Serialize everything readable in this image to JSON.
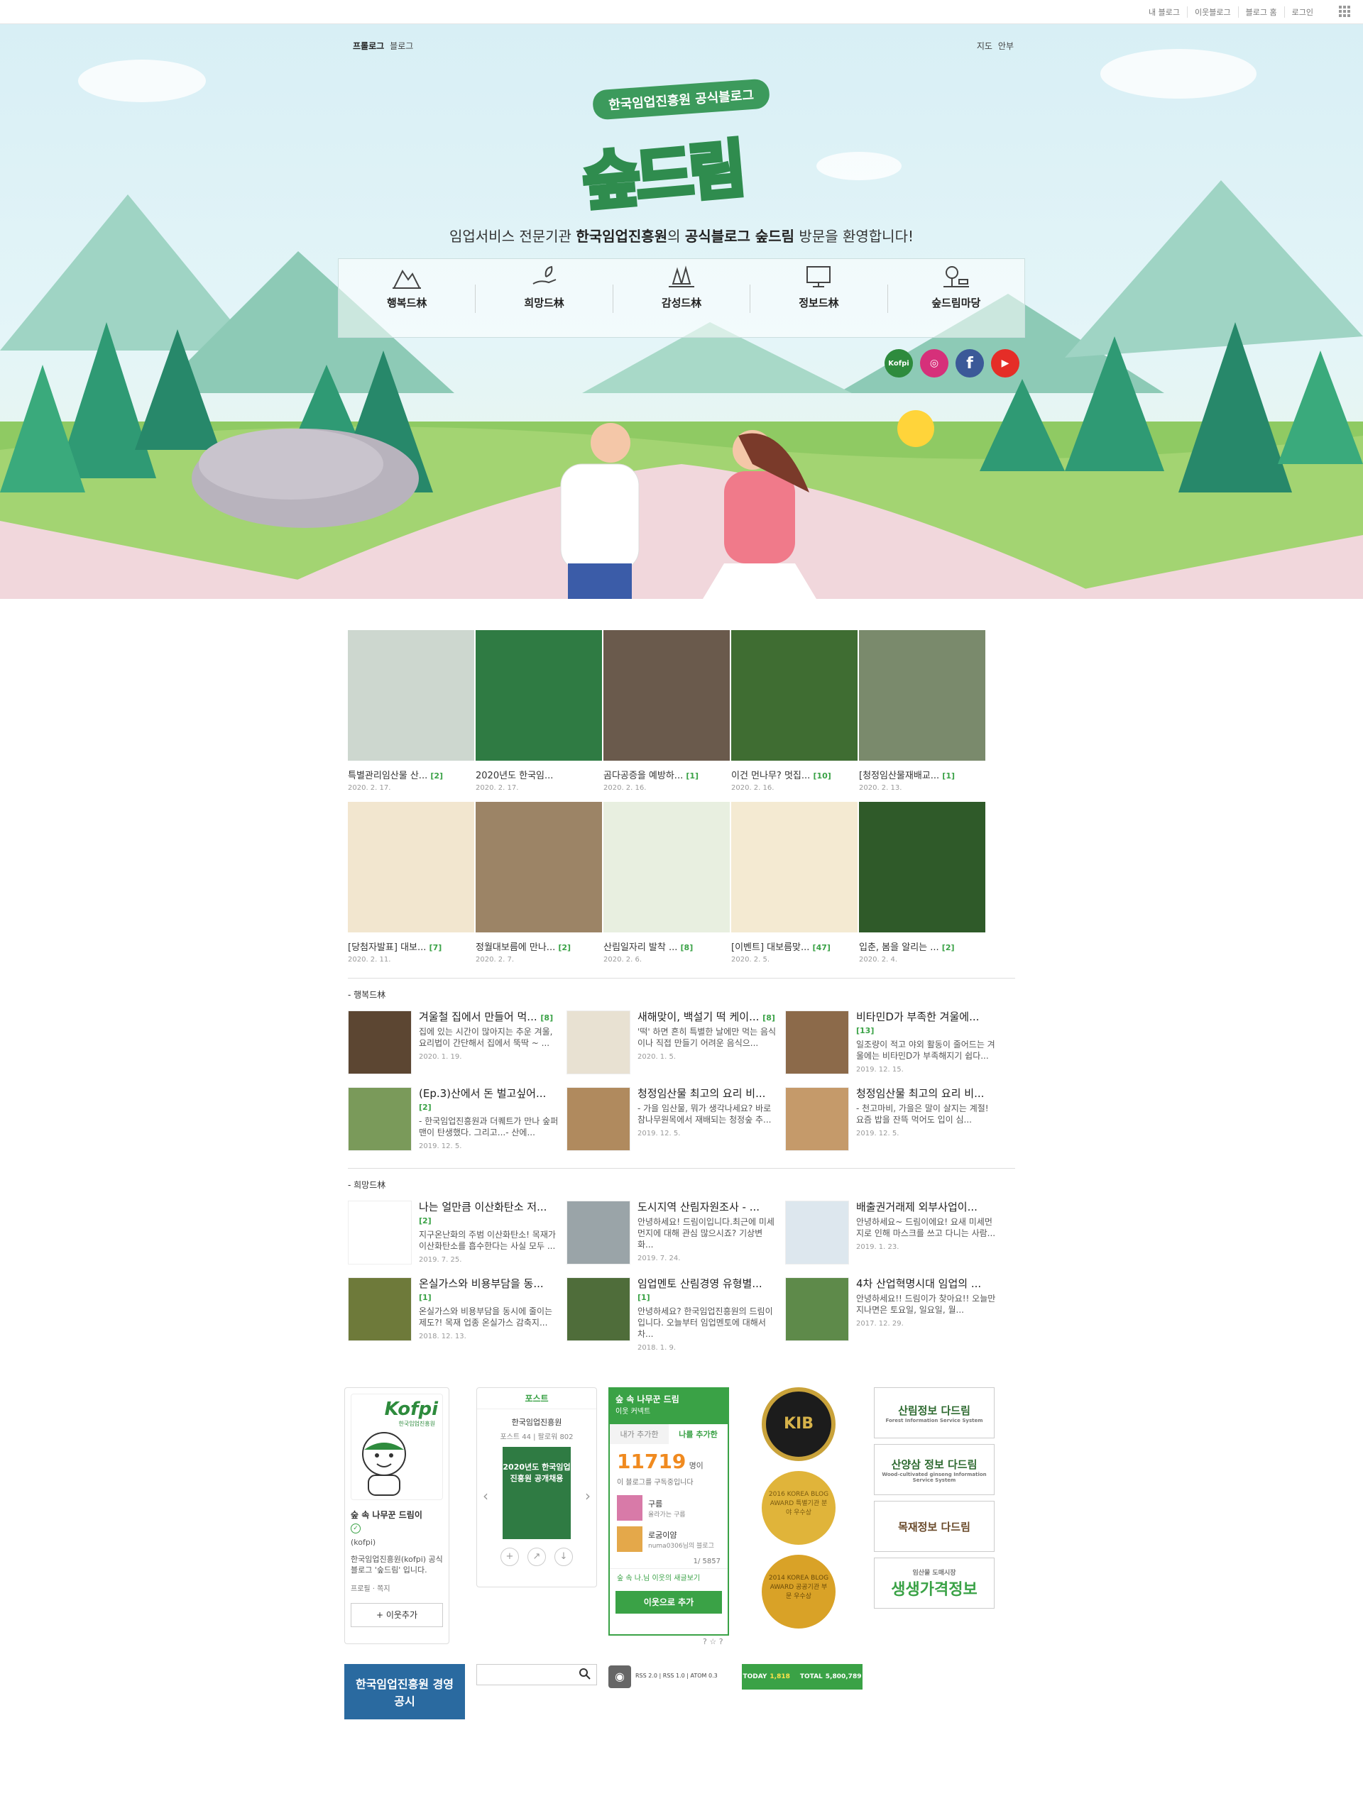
{
  "topbar": {
    "links": [
      "내 블로그",
      "이웃블로그",
      "블로그 홈",
      "로그인"
    ]
  },
  "hero": {
    "nav_left": [
      "프롤로그",
      "블로그"
    ],
    "nav_right": [
      "지도",
      "안부"
    ],
    "badge": "한국임업진흥원 공식블로그",
    "logo": "숲드림",
    "welcome_pre": "임업서비스 전문기관 ",
    "welcome_org": "한국임업진흥원",
    "welcome_mid": "의 ",
    "welcome_blog": "공식블로그 숲드림",
    "welcome_post": " 방문을 환영합니다!",
    "categories": [
      "행복드林",
      "희망드林",
      "감성드林",
      "정보드林",
      "숲드림마당"
    ],
    "sns": [
      {
        "name": "kofpi",
        "label": "Kofpi",
        "color": "#2e8b3d"
      },
      {
        "name": "instagram",
        "label": "◎",
        "color": "#d6307a"
      },
      {
        "name": "facebook",
        "label": "f",
        "color": "#3b5998"
      },
      {
        "name": "youtube",
        "label": "▶",
        "color": "#e52d27"
      }
    ]
  },
  "thumbs": [
    {
      "title": "특별관리임산물 산...",
      "count": "[2]",
      "date": "2020. 2. 17.",
      "color": "#cdd7cf"
    },
    {
      "title": "2020년도 한국임...",
      "count": "",
      "date": "2020. 2. 17.",
      "color": "#2f7b43"
    },
    {
      "title": "곰다공증을 예방하...",
      "count": "[1]",
      "date": "2020. 2. 16.",
      "color": "#6a5a4c"
    },
    {
      "title": "이건 먼나무? 멋집...",
      "count": "[10]",
      "date": "2020. 2. 16.",
      "color": "#3f6d32"
    },
    {
      "title": "[청정임산물재배교...",
      "count": "[1]",
      "date": "2020. 2. 13.",
      "color": "#7a8a6c"
    },
    {
      "title": "[당첨자발표] 대보...",
      "count": "[7]",
      "date": "2020. 2. 11.",
      "color": "#f2e6cf"
    },
    {
      "title": "정월대보름에 만나...",
      "count": "[2]",
      "date": "2020. 2. 7.",
      "color": "#9c8466"
    },
    {
      "title": "산림일자리 발착 ...",
      "count": "[8]",
      "date": "2020. 2. 6.",
      "color": "#e8efe0"
    },
    {
      "title": "[이벤트] 대보름맞...",
      "count": "[47]",
      "date": "2020. 2. 5.",
      "color": "#f4ead2"
    },
    {
      "title": "입춘, 봄을 알리는 ...",
      "count": "[2]",
      "date": "2020. 2. 4.",
      "color": "#2f5a29"
    }
  ],
  "section1": {
    "title": "- 행복드林",
    "items": [
      {
        "title": "겨울철 집에서 만들어 먹...",
        "count": "[8]",
        "desc": "집에 있는 시간이 많아지는 추운 겨울, 요리법이 간단해서 집에서 뚝딱 ~ ...",
        "date": "2020. 1. 19.",
        "color": "#5c4632"
      },
      {
        "title": "새해맞이, 백설기 떡 케이...",
        "count": "[8]",
        "desc": "'떡' 하면 흔히 특별한 날에만 먹는 음식이나 직접 만들기 어려운 음식으...",
        "date": "2020. 1. 5.",
        "color": "#e8e1d2"
      },
      {
        "title": "비타민D가 부족한 겨울에...",
        "count": "[13]",
        "desc": "일조량이 적고 야외 활동이 줄어드는 겨울에는 비타민D가 부족해지기 쉽다...",
        "date": "2019. 12. 15.",
        "color": "#8c6a4a"
      },
      {
        "title": "(Ep.3)산에서 돈 벌고싶어...",
        "count": "[2]",
        "desc": "- 한국임업진흥원과 더퀘트가 만나 숲퍼맨이 탄생했다. 그리고...- 산에...",
        "date": "2019. 12. 5.",
        "color": "#7a9a5a"
      },
      {
        "title": "청정임산물 최고의 요리 비...",
        "count": "",
        "desc": "- 가을 임산물, 뭐가 생각나세요? 바로 참나무원목에서 재배되는 청정숲 추...",
        "date": "2019. 12. 5.",
        "color": "#b08a5e"
      },
      {
        "title": "청정임산물 최고의 요리 비...",
        "count": "",
        "desc": "- 천고마비, 가을은 말이 살지는 계절! 요즘 밥을 잔뜩 먹어도 입이 심...",
        "date": "2019. 12. 5.",
        "color": "#c59a6a"
      }
    ]
  },
  "section2": {
    "title": "- 희망드林",
    "items": [
      {
        "title": "나는 얼만큼 이산화탄소 저...",
        "count": "[2]",
        "desc": "지구온난화의 주범 이산화탄소! 목재가 이산화탄소를 흡수한다는 사실 모두 ...",
        "date": "2019. 7. 25.",
        "color": "#ffffff"
      },
      {
        "title": "도시지역 산림자원조사 - ...",
        "count": "",
        "desc": "안녕하세요! 드림이입니다.최근에 미세먼지에 대해 관심 많으시죠? 기상변화...",
        "date": "2019. 7. 24.",
        "color": "#9aa4a8"
      },
      {
        "title": "배출권거래제 외부사업이...",
        "count": "",
        "desc": "안녕하세요~ 드림이에요! 요새 미세먼지로 인해 마스크를 쓰고 다니는 사람...",
        "date": "2019. 1. 23.",
        "color": "#dde7ee"
      },
      {
        "title": "온실가스와 비용부담을 동...",
        "count": "[1]",
        "desc": "온실가스와 비용부담을 동시에 줄이는 제도?! 목재 업종 온실가스 감축지...",
        "date": "2018. 12. 13.",
        "color": "#6e7a3a"
      },
      {
        "title": "임업멘토 산림경영 유형별...",
        "count": "[1]",
        "desc": "안녕하세요? 한국임업진흥원의 드림이입니다. 오늘부터 임업멘토에 대해서 차...",
        "date": "2018. 1. 9.",
        "color": "#4f6d3a"
      },
      {
        "title": "4차 산업혁명시대 임업의 ...",
        "count": "",
        "desc": "안녕하세요!! 드림이가 찾아요!! 오늘만 지나면은 토요일, 일요일, 월...",
        "date": "2017. 12. 29.",
        "color": "#5e8a4a"
      }
    ]
  },
  "profile": {
    "logo": "Kofpi",
    "logo_sub": "한국임업진흥원",
    "name": "숲 속 나무꾼 드림이",
    "id": "(kofpi)",
    "desc": "한국임업진흥원(kofpi) 공식 블로그 '숲드림' 입니다.",
    "links": "프로필 · 쪽지",
    "add_button": "+ 이웃추가"
  },
  "post_widget": {
    "tab": "포스트",
    "org": "한국임업진흥원",
    "stats": "포스트 44 | 팔로워 802",
    "cover_text": "2020년도 한국임업진흥원 공개채용"
  },
  "neighbor": {
    "header": "숲 속 나무꾼 드림",
    "sub": "이웃 커넥트",
    "tabs": [
      "내가 추가한",
      "나를 추가한"
    ],
    "count": "11719",
    "count_unit": "명이",
    "count_desc": "이 블로그를 구독중입니다",
    "people": [
      {
        "name": "구름",
        "desc": "올라가는 구름"
      },
      {
        "name": "로굼이얌",
        "desc": "numa0306님의 블로그"
      }
    ],
    "pager": "1/ 5857",
    "footer_link": "숲 속 나.님 이웃의 새글보기",
    "add_button": "이웃으로 추가"
  },
  "awards": [
    "KIB",
    "2016 KOREA BLOG AWARD 특별기관 분야 우수상",
    "2014 KOREA BLOG AWARD 공공기관 부문 우수상"
  ],
  "links": [
    {
      "main": "산림정보 다드림",
      "sub": "Forest Information Service System"
    },
    {
      "main": "산양삼 정보 다드림",
      "sub": "Wood-cultivated ginseng Information Service System"
    },
    {
      "main": "목재정보 다드림",
      "sub": ""
    },
    {
      "main": "생생가격정보",
      "sub": "임산물 도매시장"
    }
  ],
  "bottom": {
    "banner": "한국임업진흥원 경영공시",
    "rss": "RSS 2.0 | RSS 1.0 | ATOM 0.3",
    "today_label": "TODAY",
    "today": "1,818",
    "total_label": "TOTAL",
    "total": "5,800,789",
    "help": "? ☆ ?"
  }
}
